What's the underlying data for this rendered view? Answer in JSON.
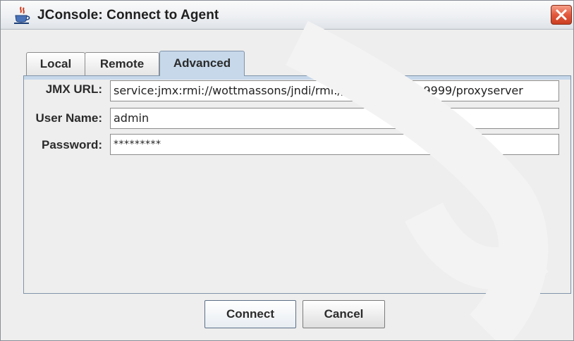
{
  "window": {
    "title": "JConsole: Connect to Agent",
    "icon": "java-coffee-cup-icon",
    "close_icon": "close-x-icon"
  },
  "tabs": [
    {
      "label": "Local",
      "active": false
    },
    {
      "label": "Remote",
      "active": false
    },
    {
      "label": "Advanced",
      "active": true
    }
  ],
  "form": {
    "jmx_url_label": "JMX URL:",
    "jmx_url_value": "service:jmx:rmi://wottmassons/jndi/rmi://wottmassons:9999/proxyserver",
    "username_label": "User Name:",
    "username_value": "admin",
    "password_label": "Password:",
    "password_value": "*********"
  },
  "buttons": {
    "connect_label": "Connect",
    "cancel_label": "Cancel"
  },
  "colors": {
    "active_tab": "#c6d8ea",
    "panel_border": "#7f93aa",
    "close_button": "#e2583c"
  }
}
